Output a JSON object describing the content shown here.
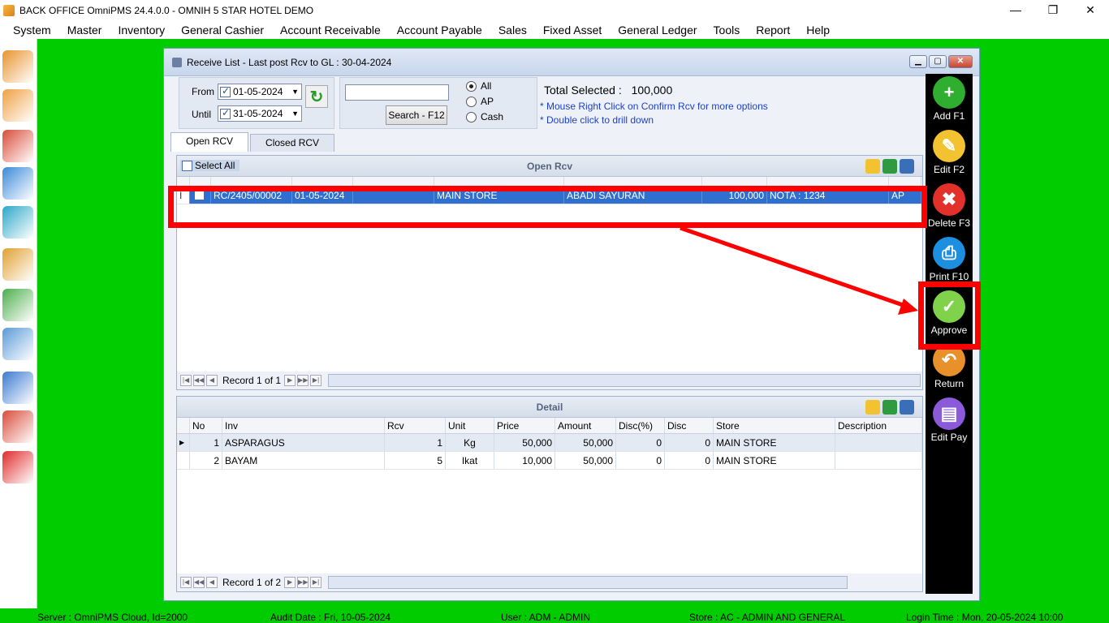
{
  "window": {
    "title": "BACK OFFICE OmniPMS 24.4.0.0 - OMNIH 5 STAR HOTEL DEMO",
    "controls": [
      "—",
      "❐",
      "✕"
    ]
  },
  "menu": [
    "System",
    "Master",
    "Inventory",
    "General Cashier",
    "Account Receivable",
    "Account Payable",
    "Sales",
    "Fixed Asset",
    "General Ledger",
    "Tools",
    "Report",
    "Help"
  ],
  "left_toolbar": [
    {
      "name": "boxes-icon",
      "color": "#e8932b"
    },
    {
      "name": "clipboard-icon",
      "color": "#f0a040"
    },
    {
      "name": "order-icon",
      "color": "#d94c3a"
    },
    {
      "name": "cart-icon",
      "color": "#3a8ad9"
    },
    {
      "name": "refresh-cycle-icon",
      "color": "#2aa8c8"
    },
    {
      "name": "money-bag-icon",
      "color": "#e0a030"
    },
    {
      "name": "hand-money-icon",
      "color": "#4cae4c"
    },
    {
      "name": "phone-touch-icon",
      "color": "#5a9ad8"
    },
    {
      "name": "calendar-icon",
      "color": "#3a7ad0"
    },
    {
      "name": "chart-icon",
      "color": "#d94c3a"
    },
    {
      "name": "exit-icon",
      "color": "#e02a2a"
    }
  ],
  "status": {
    "server": "Server : OmniPMS Cloud, Id=2000",
    "audit": "Audit Date : Fri, 10-05-2024",
    "user": "User : ADM - ADMIN",
    "store": "Store : AC - ADMIN AND GENERAL",
    "login": "Login Time : Mon, 20-05-2024 10:00"
  },
  "receive": {
    "title": "Receive List - Last post Rcv to GL : 30-04-2024",
    "from_label": "From",
    "until_label": "Until",
    "from_date": "01-05-2024",
    "until_date": "31-05-2024",
    "search_value": "",
    "search_button": "Search - F12",
    "radio": [
      "All",
      "AP",
      "Cash"
    ],
    "radio_selected": "All",
    "total_label": "Total Selected :",
    "total_value": "100,000",
    "hint1": "* Mouse Right Click on Confirm Rcv for more options",
    "hint2": "* Double click to drill down",
    "tabs": [
      "Open RCV",
      "Closed RCV"
    ],
    "select_all": "Select All",
    "open_title": "Open Rcv",
    "open_rows": [
      {
        "pointer": "I",
        "rcv_no": "RC/2405/00002",
        "date": "01-05-2024",
        "ref": "",
        "store": "MAIN STORE",
        "supplier": "ABADI SAYURAN",
        "nett": "100,000",
        "remark": "NOTA : 1234",
        "type": "AP"
      }
    ],
    "open_nav": "Record 1 of 1",
    "detail_title": "Detail",
    "detail_cols": [
      "No",
      "Inv",
      "Rcv",
      "Unit",
      "Price",
      "Amount",
      "Disc(%)",
      "Disc",
      "Store",
      "Description"
    ],
    "detail_rows": [
      {
        "no": "1",
        "inv": "ASPARAGUS",
        "rcv": "1",
        "unit": "Kg",
        "price": "50,000",
        "amount": "50,000",
        "disc_pct": "0",
        "disc": "0",
        "store": "MAIN STORE",
        "desc": ""
      },
      {
        "no": "2",
        "inv": "BAYAM",
        "rcv": "5",
        "unit": "Ikat",
        "price": "10,000",
        "amount": "50,000",
        "disc_pct": "0",
        "disc": "0",
        "store": "MAIN STORE",
        "desc": ""
      }
    ],
    "detail_nav": "Record 1 of 2"
  },
  "actions": [
    {
      "label": "Add F1",
      "color": "#2fae2f",
      "glyph": "+"
    },
    {
      "label": "Edit F2",
      "color": "#f2c230",
      "glyph": "✎"
    },
    {
      "label": "Delete F3",
      "color": "#e2302a",
      "glyph": "🗑"
    },
    {
      "label": "Print F10",
      "color": "#1d8fe0",
      "glyph": "⎙"
    },
    {
      "label": "Approve",
      "color": "#7fd24a",
      "glyph": "✓"
    },
    {
      "label": "Return",
      "color": "#e8902a",
      "glyph": "↶"
    },
    {
      "label": "Edit Pay",
      "color": "#8a5ad8",
      "glyph": "▤"
    }
  ]
}
